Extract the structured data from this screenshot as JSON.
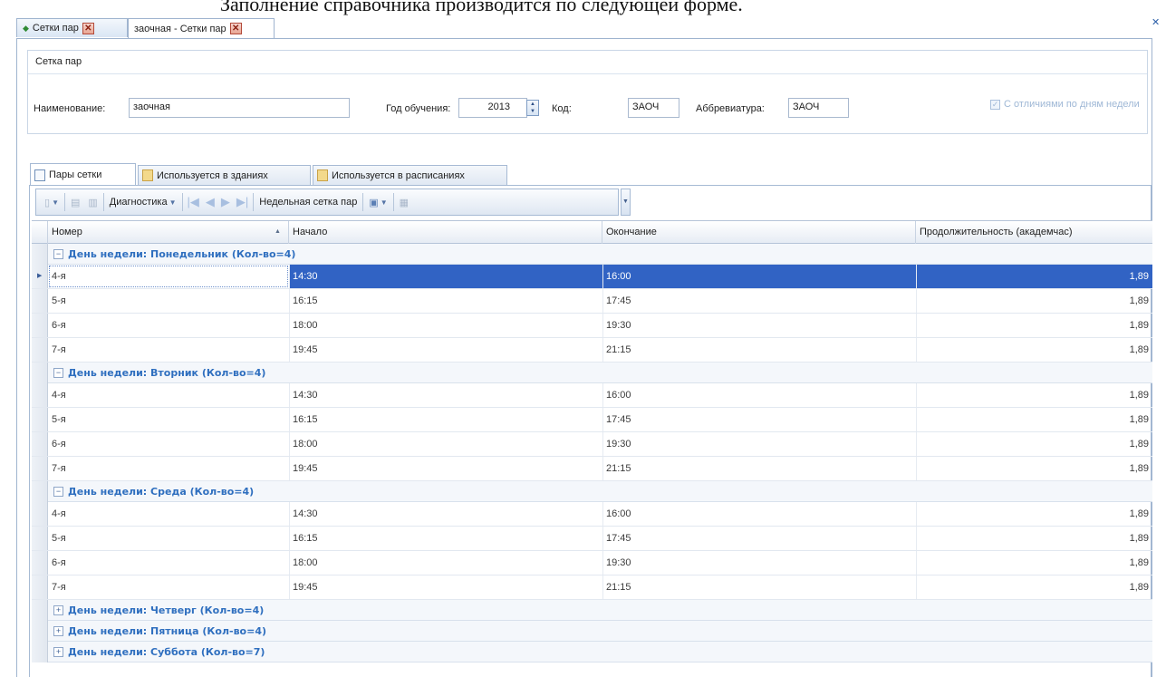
{
  "doc_text": "Заполнение справочника производится по следующей форме.",
  "tabs": [
    {
      "label": "Сетки пар",
      "close": "✕"
    },
    {
      "label": "заочная - Сетки пар",
      "close": "✕"
    }
  ],
  "group": {
    "title": "Сетка пар",
    "name_label": "Наименование:",
    "name_value": "заочная",
    "year_label": "Год обучения:",
    "year_value": "2013",
    "code_label": "Код:",
    "code_value": "ЗАОЧ",
    "abbr_label": "Аббревиатура:",
    "abbr_value": "ЗАОЧ",
    "weekday_checkbox_label": "С отличиями по дням недели"
  },
  "subtabs": [
    "Пары сетки",
    "Используется в зданиях",
    "Используется в расписаниях"
  ],
  "toolbar": {
    "diagnostics": "Диагностика",
    "weekly_grid": "Недельная сетка пар"
  },
  "columns": [
    "Номер",
    "Начало",
    "Окончание",
    "Продолжительность (академчас)"
  ],
  "groups": [
    {
      "label": "День недели: Понедельник (Кол-во=4)",
      "expanded": true,
      "rows": [
        {
          "num": "4-я",
          "start": "14:30",
          "end": "16:00",
          "dur": "1,89"
        },
        {
          "num": "5-я",
          "start": "16:15",
          "end": "17:45",
          "dur": "1,89"
        },
        {
          "num": "6-я",
          "start": "18:00",
          "end": "19:30",
          "dur": "1,89"
        },
        {
          "num": "7-я",
          "start": "19:45",
          "end": "21:15",
          "dur": "1,89"
        }
      ]
    },
    {
      "label": "День недели: Вторник (Кол-во=4)",
      "expanded": true,
      "rows": [
        {
          "num": "4-я",
          "start": "14:30",
          "end": "16:00",
          "dur": "1,89"
        },
        {
          "num": "5-я",
          "start": "16:15",
          "end": "17:45",
          "dur": "1,89"
        },
        {
          "num": "6-я",
          "start": "18:00",
          "end": "19:30",
          "dur": "1,89"
        },
        {
          "num": "7-я",
          "start": "19:45",
          "end": "21:15",
          "dur": "1,89"
        }
      ]
    },
    {
      "label": "День недели: Среда (Кол-во=4)",
      "expanded": true,
      "rows": [
        {
          "num": "4-я",
          "start": "14:30",
          "end": "16:00",
          "dur": "1,89"
        },
        {
          "num": "5-я",
          "start": "16:15",
          "end": "17:45",
          "dur": "1,89"
        },
        {
          "num": "6-я",
          "start": "18:00",
          "end": "19:30",
          "dur": "1,89"
        },
        {
          "num": "7-я",
          "start": "19:45",
          "end": "21:15",
          "dur": "1,89"
        }
      ]
    },
    {
      "label": "День недели: Четверг (Кол-во=4)",
      "expanded": false,
      "rows": []
    },
    {
      "label": "День недели: Пятница (Кол-во=4)",
      "expanded": false,
      "rows": []
    },
    {
      "label": "День недели: Суббота (Кол-во=7)",
      "expanded": false,
      "rows": []
    }
  ],
  "colors": {
    "selection": "#3163c4",
    "group_text": "#2f6fbf"
  }
}
